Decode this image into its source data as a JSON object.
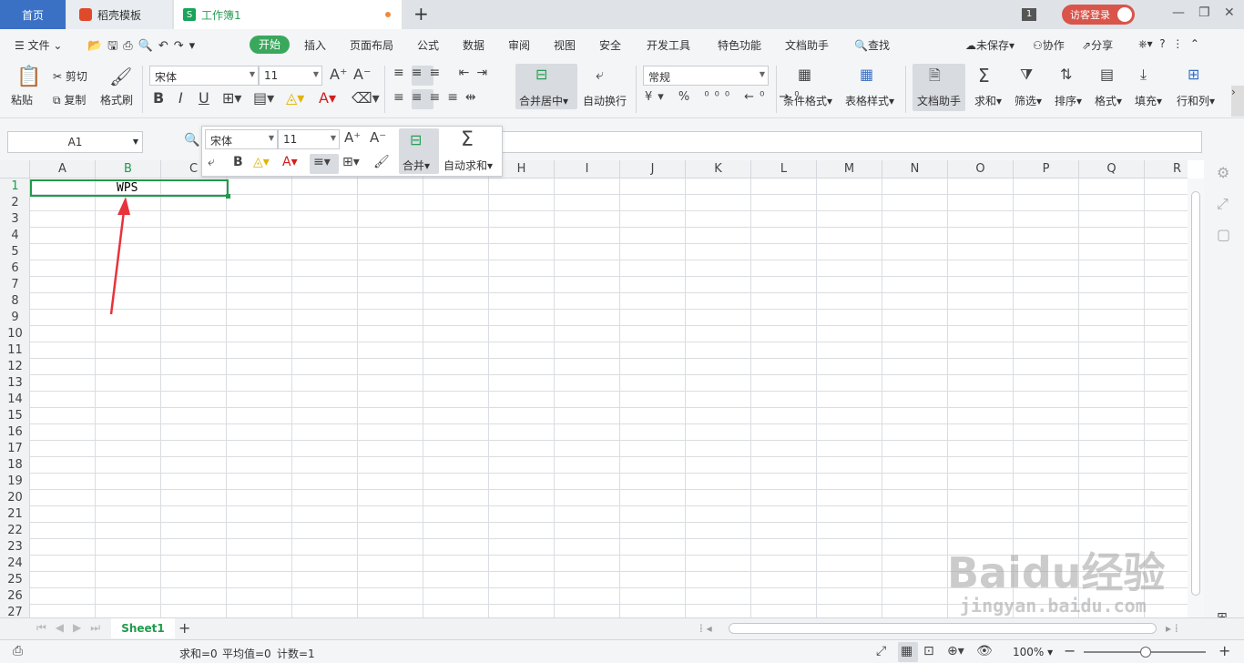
{
  "tabs": {
    "home": "首页",
    "template": "稻壳模板",
    "workbook": "工作簿1",
    "new_tab": "+"
  },
  "titlebar": {
    "badge": "1",
    "login": "访客登录"
  },
  "menu": {
    "file": "文件",
    "items": [
      "开始",
      "插入",
      "页面布局",
      "公式",
      "数据",
      "审阅",
      "视图",
      "安全",
      "开发工具",
      "特色功能",
      "文档助手"
    ],
    "search": "查找",
    "unsaved": "未保存",
    "collab": "协作",
    "share": "分享"
  },
  "ribbon": {
    "paste": "粘贴",
    "cut": "剪切",
    "copy": "复制",
    "format_painter": "格式刷",
    "font_name": "宋体",
    "font_size": "11",
    "merge_center": "合并居中",
    "wrap_text": "自动换行",
    "number_format": "常规",
    "conditional_format": "条件格式",
    "table_style": "表格样式",
    "doc_assistant": "文档助手",
    "sum": "求和",
    "filter": "筛选",
    "sort": "排序",
    "format": "格式",
    "fill": "填充",
    "row_col": "行和列"
  },
  "formula_bar": {
    "name_box": "A1",
    "value": ""
  },
  "mini_toolbar": {
    "font_name": "宋体",
    "font_size": "11",
    "merge": "合并",
    "autosum": "自动求和"
  },
  "grid": {
    "columns": [
      "A",
      "B",
      "C",
      "D",
      "E",
      "F",
      "G",
      "H",
      "I",
      "J",
      "K",
      "L",
      "M",
      "N",
      "O",
      "P",
      "Q",
      "R"
    ],
    "rows": [
      "1",
      "2",
      "3",
      "4",
      "5",
      "6",
      "7",
      "8",
      "9",
      "10",
      "11",
      "12",
      "13",
      "14",
      "15",
      "16",
      "17",
      "18",
      "19",
      "20",
      "21",
      "22",
      "23",
      "24",
      "25",
      "26",
      "27"
    ],
    "cell_B1": "WPS",
    "active_col": "B"
  },
  "sheets": {
    "active": "Sheet1"
  },
  "status": {
    "sum": "求和=0",
    "avg": "平均值=0",
    "count": "计数=1",
    "zoom": "100%"
  },
  "watermark": {
    "text": "Baidu经验",
    "url": "jingyan.baidu.com"
  },
  "colors": {
    "accent": "#3aa85c",
    "selection": "#1f9b4b",
    "home_tab": "#3a71c4",
    "arrow": "#e8333a"
  }
}
